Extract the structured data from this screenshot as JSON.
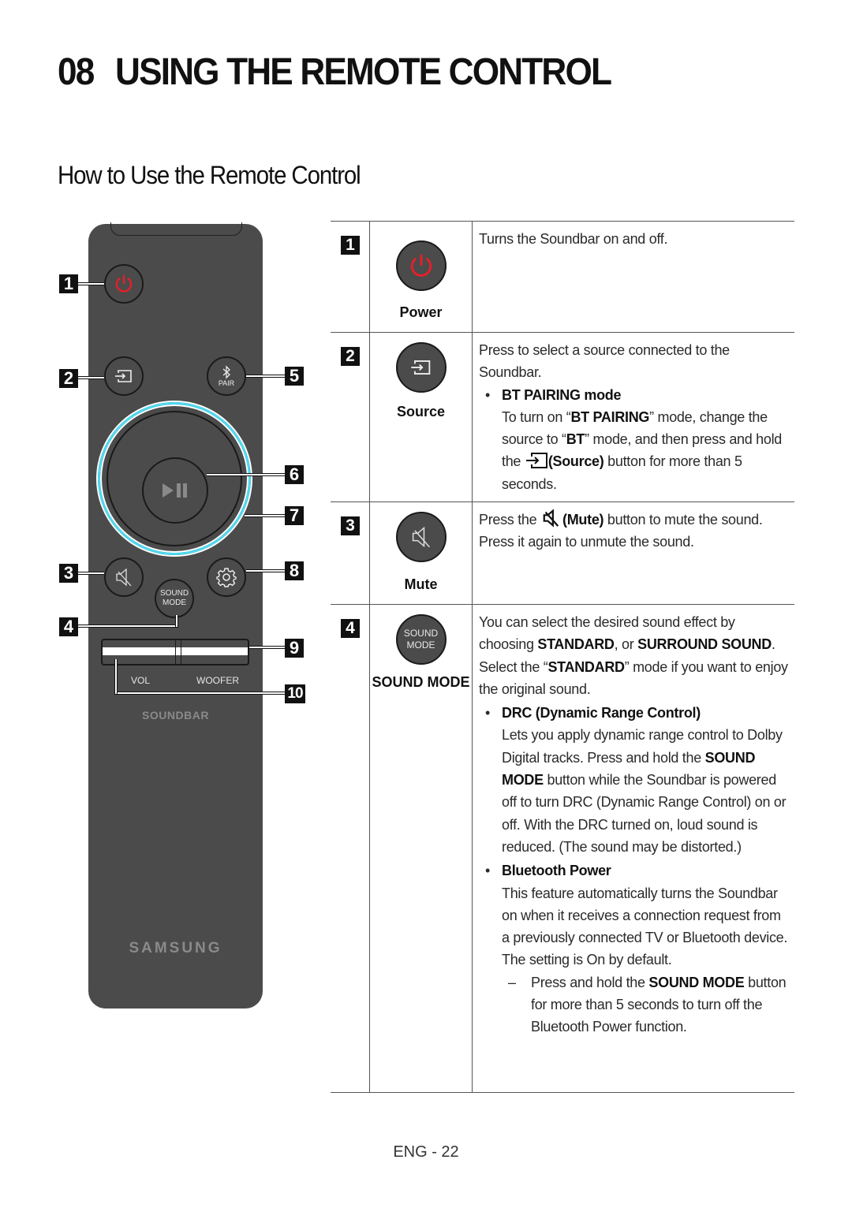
{
  "header": {
    "chapter_number": "08",
    "chapter_title": "USING THE REMOTE CONTROL",
    "section_title": "How to Use the Remote Control"
  },
  "remote": {
    "callouts": [
      "1",
      "2",
      "3",
      "4",
      "5",
      "6",
      "7",
      "8",
      "9",
      "10"
    ],
    "pair_label": "PAIR",
    "sound_mode_label_1": "SOUND",
    "sound_mode_label_2": "MODE",
    "vol_label": "VOL",
    "woofer_label": "WOOFER",
    "soundbar_label": "SOUNDBAR",
    "brand": "SAMSUNG",
    "colors": {
      "body": "#4b4b4b",
      "power": "#e5202a",
      "ring": "#4fd8ee"
    }
  },
  "table": {
    "rows": [
      {
        "num": "1",
        "icon": "power-icon",
        "label": "Power",
        "text": "Turns the Soundbar on and off."
      },
      {
        "num": "2",
        "icon": "source-icon",
        "label": "Source",
        "intro": "Press to select a source connected to the Soundbar.",
        "bullet_title": "BT PAIRING mode",
        "b_t1": "To turn on “",
        "b_bold1": "BT PAIRING",
        "b_t2": "” mode, change the source to “",
        "b_bold2": "BT",
        "b_t3": "” mode, and then press and hold the ",
        "b_bold3": "(Source)",
        "b_t4": " button for more than 5 seconds."
      },
      {
        "num": "3",
        "icon": "mute-icon",
        "label": "Mute",
        "t1": "Press the ",
        "bold1": "(Mute)",
        "t2": " button to mute the sound. Press it again to unmute the sound."
      },
      {
        "num": "4",
        "icon": "sound-mode-icon",
        "btn_text_1": "SOUND",
        "btn_text_2": "MODE",
        "label": "SOUND MODE",
        "t1": "You can select the desired sound effect by choosing ",
        "bold1": "STANDARD",
        "t2": ", or ",
        "bold2": "SURROUND SOUND",
        "t3": ". Select the “",
        "bold3": "STANDARD",
        "t4": "” mode if you want to enjoy the original sound.",
        "drc_title": "DRC (Dynamic Range Control)",
        "drc_t1": "Lets you apply dynamic range control to Dolby Digital tracks. Press and hold the ",
        "drc_bold": "SOUND MODE",
        "drc_t2": " button while the Soundbar is powered off to turn DRC (Dynamic Range Control) on or off. With the DRC turned on, loud sound is reduced. (The sound may be distorted.)",
        "bt_title": "Bluetooth Power",
        "bt_text": "This feature automatically turns the Soundbar on when it receives a connection request from a previously connected TV or Bluetooth device. The setting is On by default.",
        "dash_t1": "Press and hold the ",
        "dash_bold": "SOUND MODE",
        "dash_t2": " button for more than 5 seconds to turn off the Bluetooth Power function."
      }
    ]
  },
  "footer": {
    "page": "ENG - 22"
  }
}
